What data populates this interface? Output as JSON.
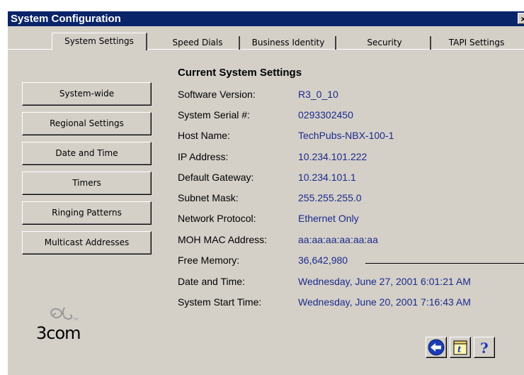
{
  "window": {
    "title": "System Configuration",
    "close_glyph": "×"
  },
  "tabs": [
    {
      "label": "System Settings",
      "active": true
    },
    {
      "label": "Speed Dials"
    },
    {
      "label": "Business Identity"
    },
    {
      "label": "Security"
    },
    {
      "label": "TAPI Settings"
    }
  ],
  "sidebar": {
    "buttons": [
      {
        "label": "System-wide"
      },
      {
        "label": "Regional Settings"
      },
      {
        "label": "Date and Time"
      },
      {
        "label": "Timers"
      },
      {
        "label": "Ringing Patterns"
      },
      {
        "label": "Multicast Addresses"
      }
    ]
  },
  "settings": {
    "heading": "Current System Settings",
    "rows": [
      {
        "label": "Software Version:",
        "value": "R3_0_10"
      },
      {
        "label": "System Serial #:",
        "value": "0293302450"
      },
      {
        "label": "Host Name:",
        "value": "TechPubs-NBX-100-1"
      },
      {
        "label": "IP Address:",
        "value": "10.234.101.222"
      },
      {
        "label": "Default Gateway:",
        "value": "10.234.101.1"
      },
      {
        "label": "Subnet Mask:",
        "value": "255.255.255.0"
      },
      {
        "label": "Network Protocol:",
        "value": "Ethernet Only"
      },
      {
        "label": "MOH MAC Address:",
        "value": "aa:aa:aa:aa:aa:aa"
      },
      {
        "label": "Free Memory:",
        "value": "36,642,980"
      },
      {
        "label": "Date and Time:",
        "value": "Wednesday, June 27, 2001 6:01:21 AM"
      },
      {
        "label": "System Start Time:",
        "value": "Wednesday, June 20, 2001 7:16:43 AM"
      }
    ]
  },
  "branding": {
    "logo_text": "3com"
  },
  "icons": {
    "back": "back-arrow-icon",
    "notes": "notepad-icon",
    "help": "help-question-icon"
  },
  "colors": {
    "titlebar": "#0a246a",
    "value_text": "#1c2a8c",
    "panel": "#d4d0c8"
  }
}
